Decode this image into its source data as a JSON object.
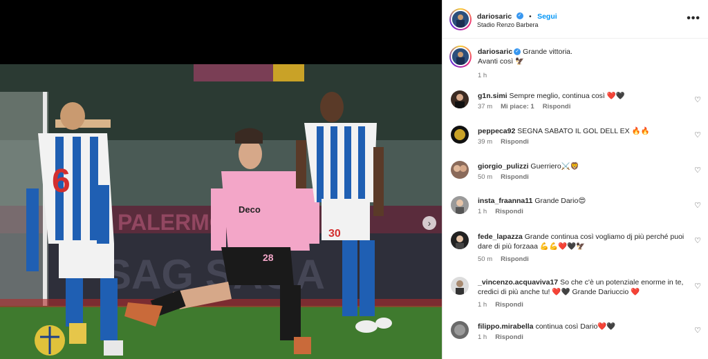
{
  "post_author": {
    "username": "dariosaric",
    "follow_label": "Segui",
    "location": "Stadio Renzo Barbera",
    "more_label": "•••"
  },
  "caption": {
    "username": "dariosaric",
    "line1": "Grande vittoria.",
    "line2": "Avanti così 🦅",
    "time": "1 h"
  },
  "comments": [
    {
      "username": "g1n.simi",
      "text": "Sempre meglio, continua così ❤️🖤",
      "time": "37 m",
      "likes": "Mi piace: 1",
      "reply": "Rispondi"
    },
    {
      "username": "peppeca92",
      "text": "SEGNA SABATO IL GOL DELL EX 🔥🔥",
      "time": "39 m",
      "likes": "",
      "reply": "Rispondi"
    },
    {
      "username": "giorgio_pulizzi",
      "text": "Guerriero⚔️🦁",
      "time": "50 m",
      "likes": "",
      "reply": "Rispondi"
    },
    {
      "username": "insta_fraanna11",
      "text": "Grande Dario😍",
      "time": "1 h",
      "likes": "",
      "reply": "Rispondi"
    },
    {
      "username": "fede_lapazza",
      "text": "Grande continua così vogliamo dj più perché puoi dare di più forzaaa 💪💪❤️🖤🦅",
      "time": "50 m",
      "likes": "",
      "reply": "Rispondi"
    },
    {
      "username": "_vincenzo.acquaviva17",
      "text": "So che c'è un potenziale enorme in te, credici di più anche tu! ❤️🖤 Grande Dariuccio ❤️",
      "time": "1 h",
      "likes": "",
      "reply": "Rispondi"
    },
    {
      "username": "filippo.mirabella",
      "text": "continua così Dario❤️🖤",
      "time": "1 h",
      "likes": "",
      "reply": "Rispondi"
    }
  ],
  "icons": {
    "heart": "heart-outline-icon",
    "verified": "verified-badge-icon",
    "next": "chevron-right-icon",
    "more": "more-options-icon"
  },
  "colors": {
    "follow": "#0095f6",
    "verified": "#3897f0",
    "pink_kit": "#f3a6c8",
    "pitch": "#3f7a2e"
  }
}
